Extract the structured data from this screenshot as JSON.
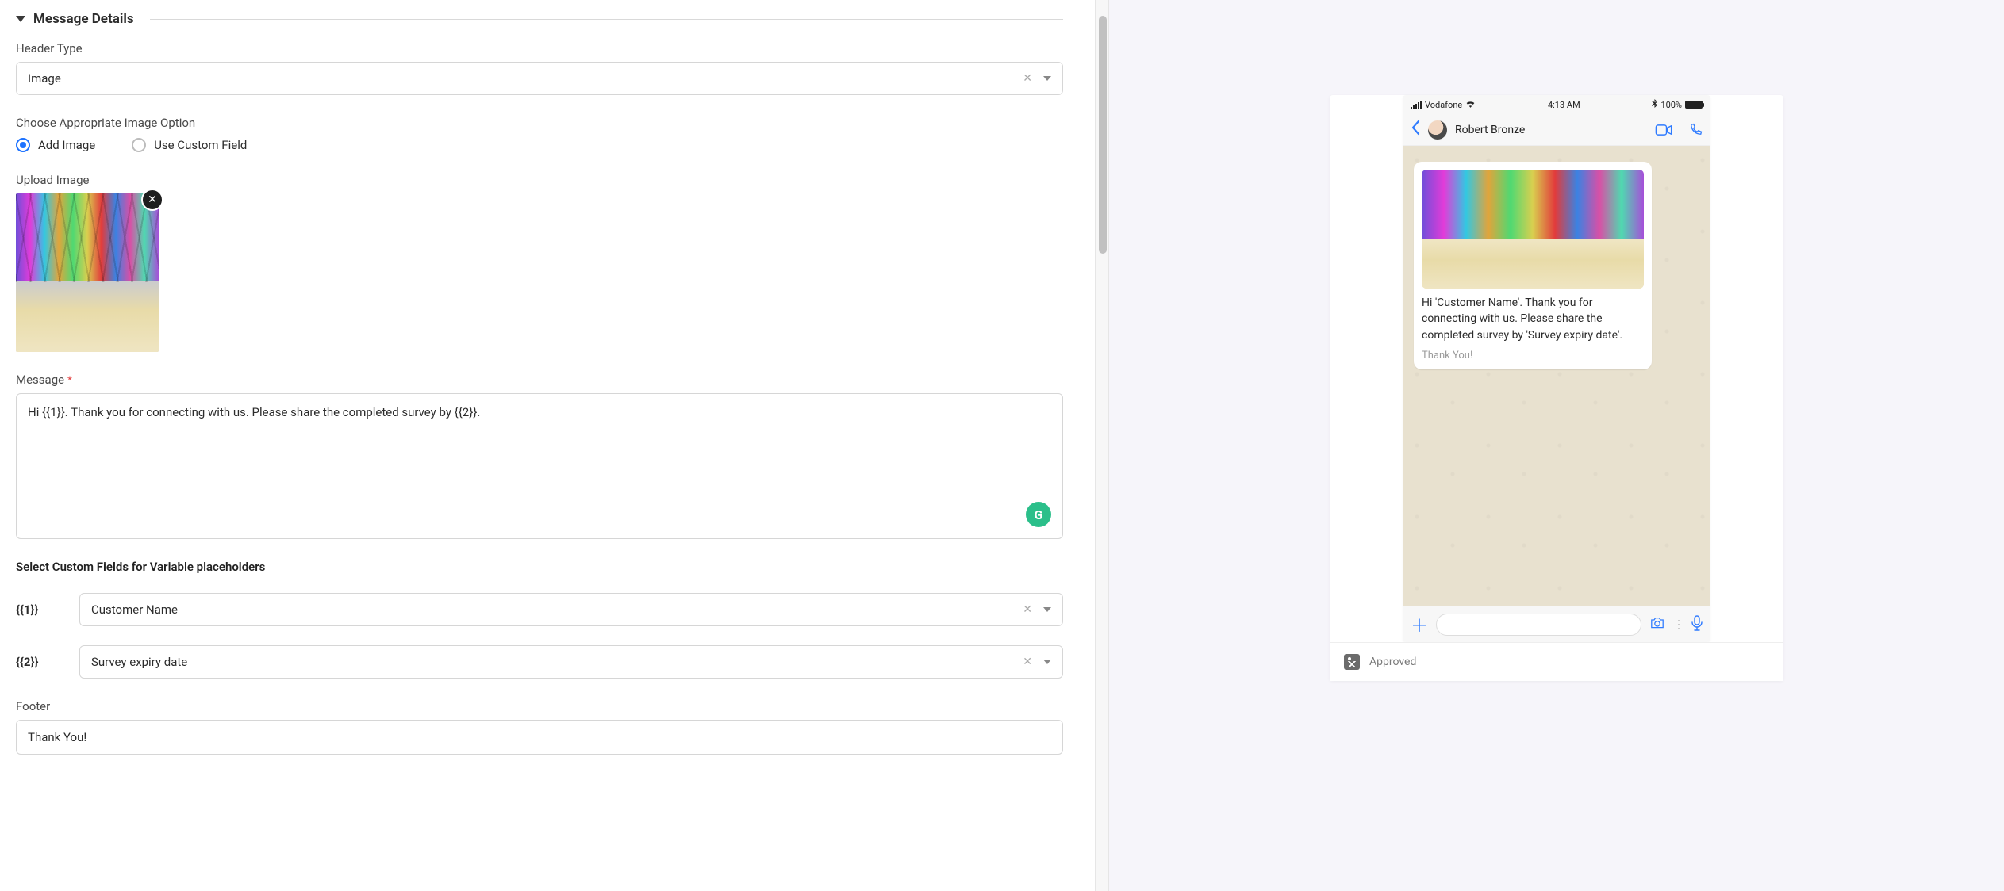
{
  "section": {
    "title": "Message Details"
  },
  "headerType": {
    "label": "Header Type",
    "value": "Image"
  },
  "imageOption": {
    "label": "Choose Appropriate Image Option",
    "add": "Add Image",
    "custom": "Use Custom Field",
    "selected": "add"
  },
  "uploadImage": {
    "label": "Upload Image"
  },
  "message": {
    "label": "Message",
    "value": "Hi {{1}}. Thank you for connecting with us. Please share the completed survey by {{2}}."
  },
  "varSection": {
    "label": "Select Custom Fields for Variable placeholders"
  },
  "vars": [
    {
      "token": "{{1}}",
      "value": "Customer Name"
    },
    {
      "token": "{{2}}",
      "value": "Survey expiry date"
    }
  ],
  "footer": {
    "label": "Footer",
    "value": "Thank You!"
  },
  "preview": {
    "status": {
      "carrier": "Vodafone",
      "time": "4:13 AM",
      "battery": "100%"
    },
    "contact": "Robert Bronze",
    "bubbleText": "Hi 'Customer Name'. Thank you for connecting with us. Please share the completed survey by 'Survey expiry date'.",
    "bubbleFooter": "Thank You!",
    "approval": "Approved"
  }
}
